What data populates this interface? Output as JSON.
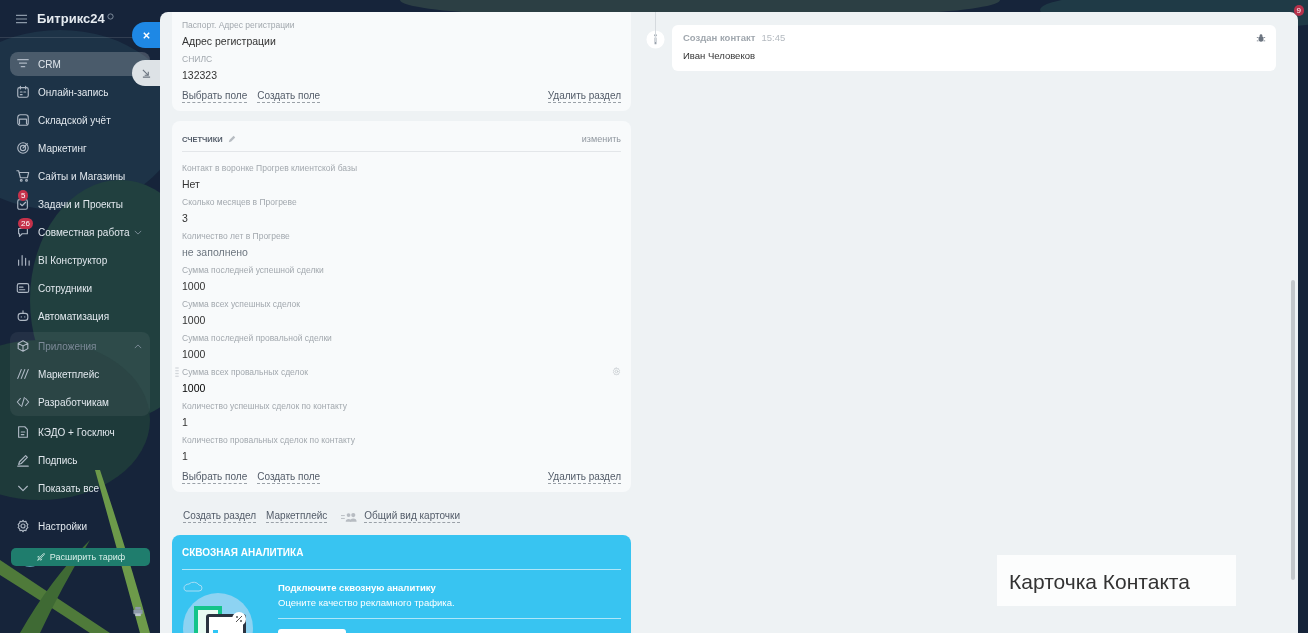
{
  "sidebar": {
    "logo": "Битрикс24",
    "items": [
      {
        "label": "CRM",
        "selected": true
      },
      {
        "label": "Онлайн-запись",
        "selected": false
      },
      {
        "label": "Складской учёт",
        "selected": false
      },
      {
        "label": "Маркетинг",
        "selected": false
      },
      {
        "label": "Сайты и Магазины",
        "selected": false
      },
      {
        "label": "Задачи и Проекты",
        "selected": false,
        "badge": "5"
      },
      {
        "label": "Совместная работа",
        "selected": false,
        "badge": "26",
        "expanded": false
      },
      {
        "label": "BI Конструктор",
        "selected": false
      },
      {
        "label": "Сотрудники",
        "selected": false
      },
      {
        "label": "Автоматизация",
        "selected": false
      },
      {
        "label": "Приложения",
        "selected": false,
        "expanded": true,
        "children": [
          {
            "label": "Маркетплейс",
            "selected": false
          },
          {
            "label": "Разработчикам",
            "selected": false
          }
        ]
      },
      {
        "label": "КЭДО + Госключ",
        "selected": false
      },
      {
        "label": "Подпись",
        "selected": false
      },
      {
        "label": "Показать все",
        "selected": false
      }
    ],
    "settings_item": {
      "label": "Настройки",
      "selected": false
    },
    "upgrade_button": "Расширить тариф"
  },
  "notifications_badge": "9",
  "sections": [
    {
      "fields": [
        {
          "label": "Паспорт. Адрес регистрации",
          "value": "Адрес регистрации",
          "empty": false,
          "hovered": false
        },
        {
          "label": "СНИЛС",
          "value": "132323",
          "empty": false,
          "hovered": false
        }
      ],
      "actions": {
        "select_field": "Выбрать поле",
        "create_field": "Создать поле",
        "delete_section": "Удалить раздел"
      }
    },
    {
      "title": "СЧЕТЧИКИ",
      "edit_link": "изменить",
      "fields": [
        {
          "label": "Контакт в воронке Прогрев клиентской базы",
          "value": "Нет",
          "empty": false,
          "hovered": false
        },
        {
          "label": "Сколько месяцев в Прогреве",
          "value": "3",
          "empty": false,
          "hovered": false
        },
        {
          "label": "Количество лет в Прогреве",
          "value": "не заполнено",
          "empty": true,
          "hovered": false
        },
        {
          "label": "Сумма последней успешной сделки",
          "value": "1000",
          "empty": false,
          "hovered": false
        },
        {
          "label": "Сумма всех успешных сделок",
          "value": "1000",
          "empty": false,
          "hovered": false
        },
        {
          "label": "Сумма последней провальной сделки",
          "value": "1000",
          "empty": false,
          "hovered": false
        },
        {
          "label": "Сумма всех провальных сделок",
          "value": "1000",
          "empty": false,
          "hovered": true
        },
        {
          "label": "Количество успешных сделок по контакту",
          "value": "1",
          "empty": false,
          "hovered": false
        },
        {
          "label": "Количество провальных сделок по контакту",
          "value": "1",
          "empty": false,
          "hovered": false
        }
      ],
      "actions": {
        "select_field": "Выбрать поле",
        "create_field": "Создать поле",
        "delete_section": "Удалить раздел"
      }
    }
  ],
  "section_links": [
    "Создать раздел",
    "Маркетплейс"
  ],
  "card_view_link": "Общий вид карточки",
  "analytics_banner": {
    "title": "СКВОЗНАЯ АНАЛИТИКА",
    "heading": "Подключите сквозную аналитику",
    "text": "Оцените качество рекламного трафика."
  },
  "timeline": {
    "entries": [
      {
        "title": "Создан контакт",
        "time": "15:45",
        "text": "Иван Человеков"
      }
    ]
  },
  "caption": "Карточка Контакта"
}
